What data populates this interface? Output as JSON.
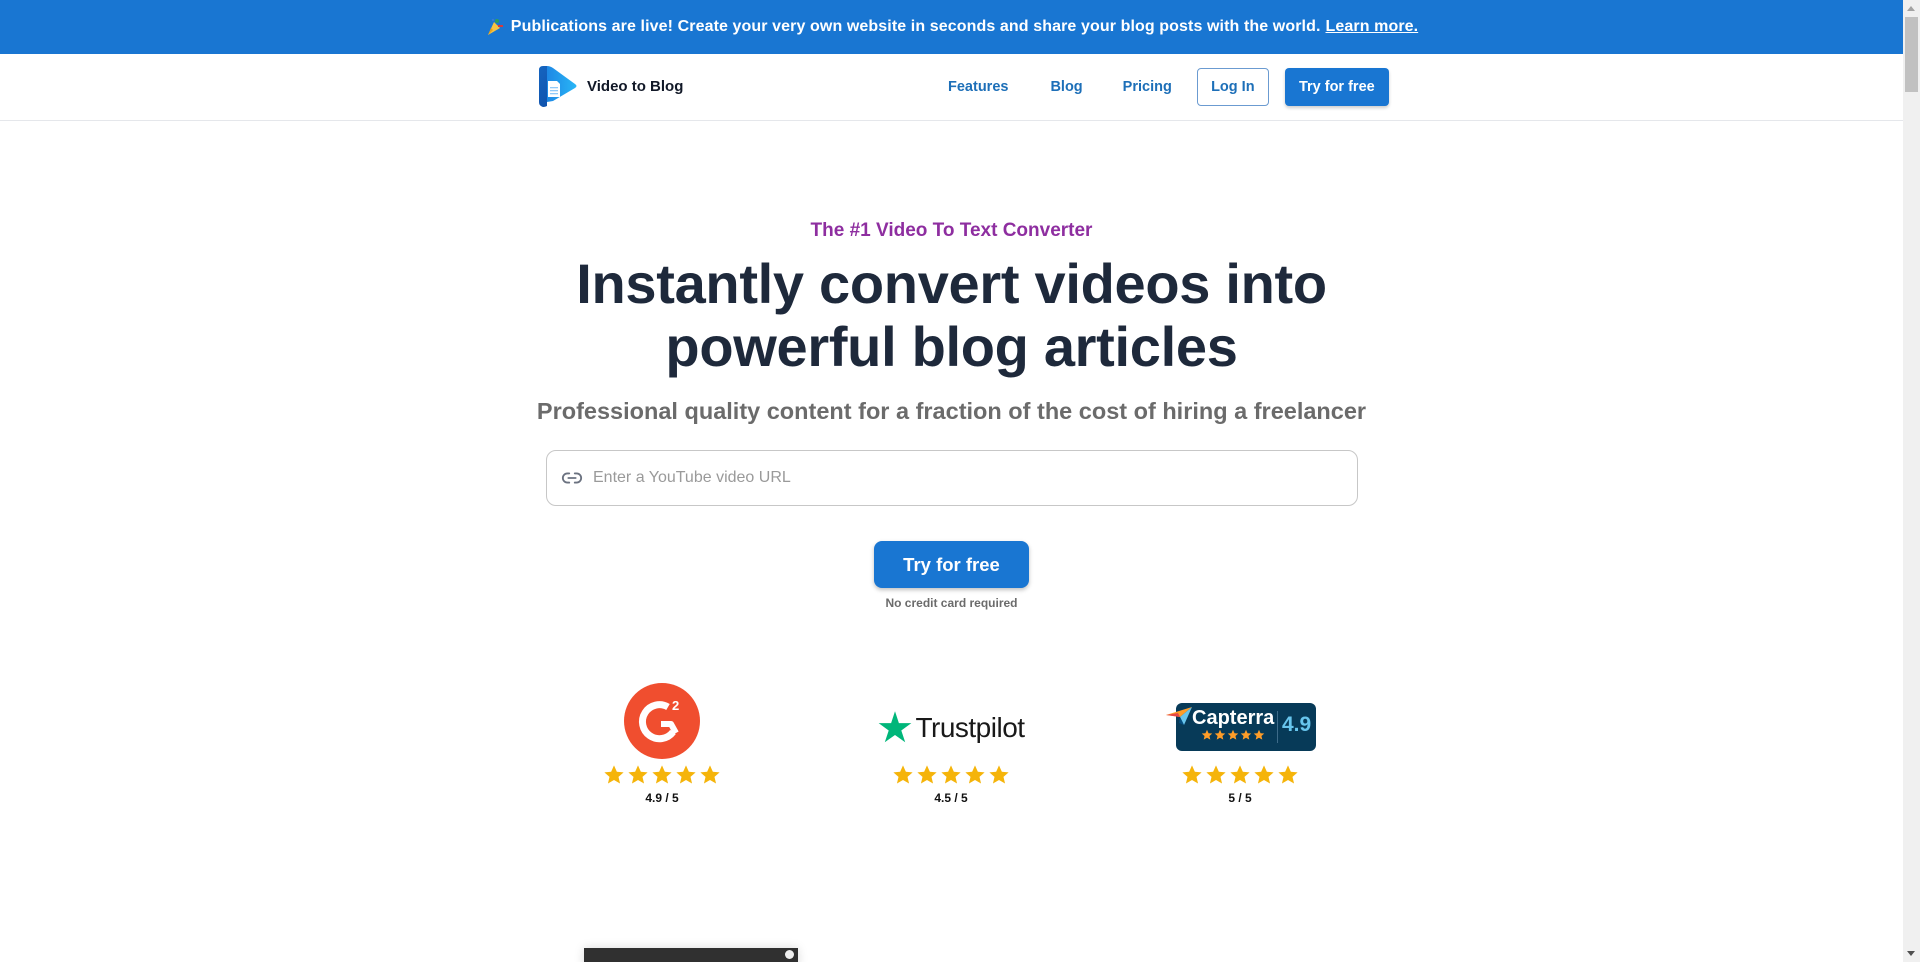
{
  "announcement": {
    "icon": "party-popper-icon",
    "text": "Publications are live! Create your very own website in seconds and share your blog posts with the world.",
    "link_label": "Learn more."
  },
  "nav": {
    "brand_name": "Video to Blog",
    "links": [
      {
        "label": "Features"
      },
      {
        "label": "Blog"
      },
      {
        "label": "Pricing"
      }
    ],
    "login_label": "Log In",
    "try_label": "Try for free"
  },
  "hero": {
    "eyebrow": "The #1 Video To Text Converter",
    "headline_line1": "Instantly convert videos into",
    "headline_line2": "powerful blog articles",
    "subhead": "Professional quality content for a fraction of the cost of hiring a freelancer",
    "url_input": {
      "value": "",
      "placeholder": "Enter a YouTube video URL",
      "icon": "link-icon"
    },
    "cta_label": "Try for free",
    "cta_note": "No credit card required"
  },
  "ratings": [
    {
      "platform": "G2",
      "stars": 5,
      "score": "4.9 / 5"
    },
    {
      "platform": "Trustpilot",
      "wordmark": "Trustpilot",
      "stars": 5,
      "score": "4.5 / 5"
    },
    {
      "platform": "Capterra",
      "wordmark": "Capterra",
      "badge_score": "4.9",
      "stars": 5,
      "score": "5 / 5"
    }
  ],
  "colors": {
    "brand_blue": "#1976d2",
    "eyebrow_purple": "#8e2ea0",
    "headline": "#1e293b",
    "star": "#f5b40a",
    "g2_red": "#f04e2f",
    "trustpilot_green": "#00b67a",
    "capterra_navy": "#073a58"
  }
}
